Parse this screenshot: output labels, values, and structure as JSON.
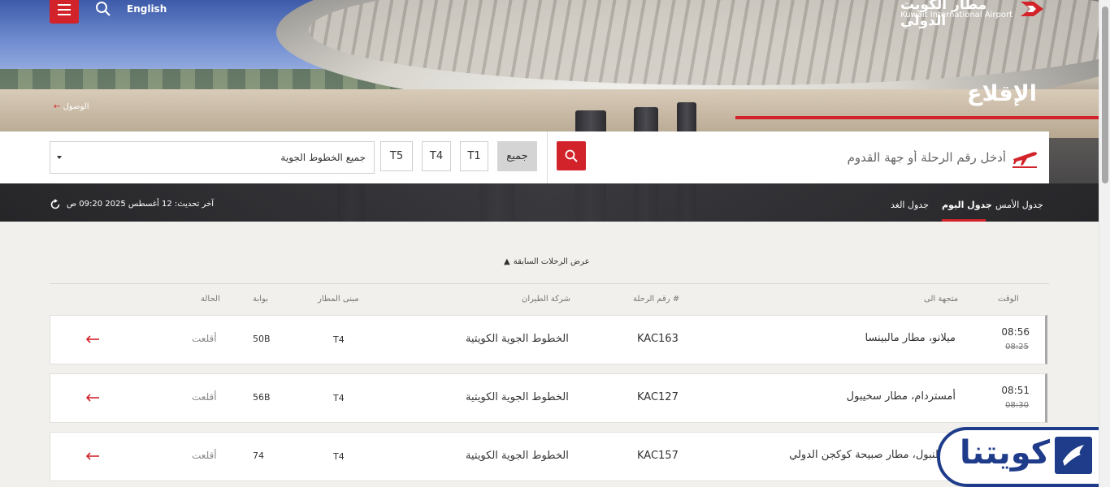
{
  "header": {
    "language_link": "English",
    "logo_ar": "مطار الكويت الدولي",
    "logo_en": "Kuwait International Airport",
    "arrivals_link": "الوصول",
    "page_title": "الإقلاع"
  },
  "search": {
    "placeholder": "أدخل رقم الرحلة أو جهة القدوم",
    "airline_select_value": "جميع الخطوط الجوية",
    "terminals": [
      "جميع",
      "T1",
      "T4",
      "T5"
    ],
    "active_terminal": "جميع"
  },
  "schedule": {
    "tabs": [
      "جدول الأمس",
      "جدول اليوم",
      "جدول الغد"
    ],
    "active_tab": "جدول اليوم",
    "last_updated": "آخر تحديث: 12 أغسطس 2025 09:20 ص"
  },
  "list": {
    "show_previous": "عرض الرحلات السابقة",
    "columns": {
      "time": "الوقت",
      "destination": "متجهة الى",
      "flight_no": "رقم الرحلة #",
      "airline": "شركة الطيران",
      "terminal": "مبنى المطار",
      "gate": "بوابة",
      "status": "الحالة"
    },
    "flights": [
      {
        "time": "08:56",
        "scheduled": "08:25",
        "destination": "ميلانو، مطار مالبينسا",
        "flight_no": "KAC163",
        "airline": "الخطوط الجوية الكويتية",
        "terminal": "T4",
        "gate": "50B",
        "status": "أقلعت"
      },
      {
        "time": "08:51",
        "scheduled": "08:30",
        "destination": "أمستردام، مطار سخيبول",
        "flight_no": "KAC127",
        "airline": "الخطوط الجوية الكويتية",
        "terminal": "T4",
        "gate": "56B",
        "status": "أقلعت"
      },
      {
        "time": "",
        "scheduled": "",
        "destination": "اسطنبول، مطار صبيحة كوكجن الدولي",
        "flight_no": "KAC157",
        "airline": "الخطوط الجوية الكويتية",
        "terminal": "T4",
        "gate": "74",
        "status": "أقلعت"
      }
    ]
  },
  "badge": {
    "text": "كويتنا"
  },
  "colors": {
    "accent": "#d2232a",
    "badge_blue": "#1f3c8a"
  },
  "icons": [
    "menu-icon",
    "search-icon",
    "plane-icon",
    "refresh-icon",
    "chevron-up-icon",
    "arrow-left-icon"
  ]
}
